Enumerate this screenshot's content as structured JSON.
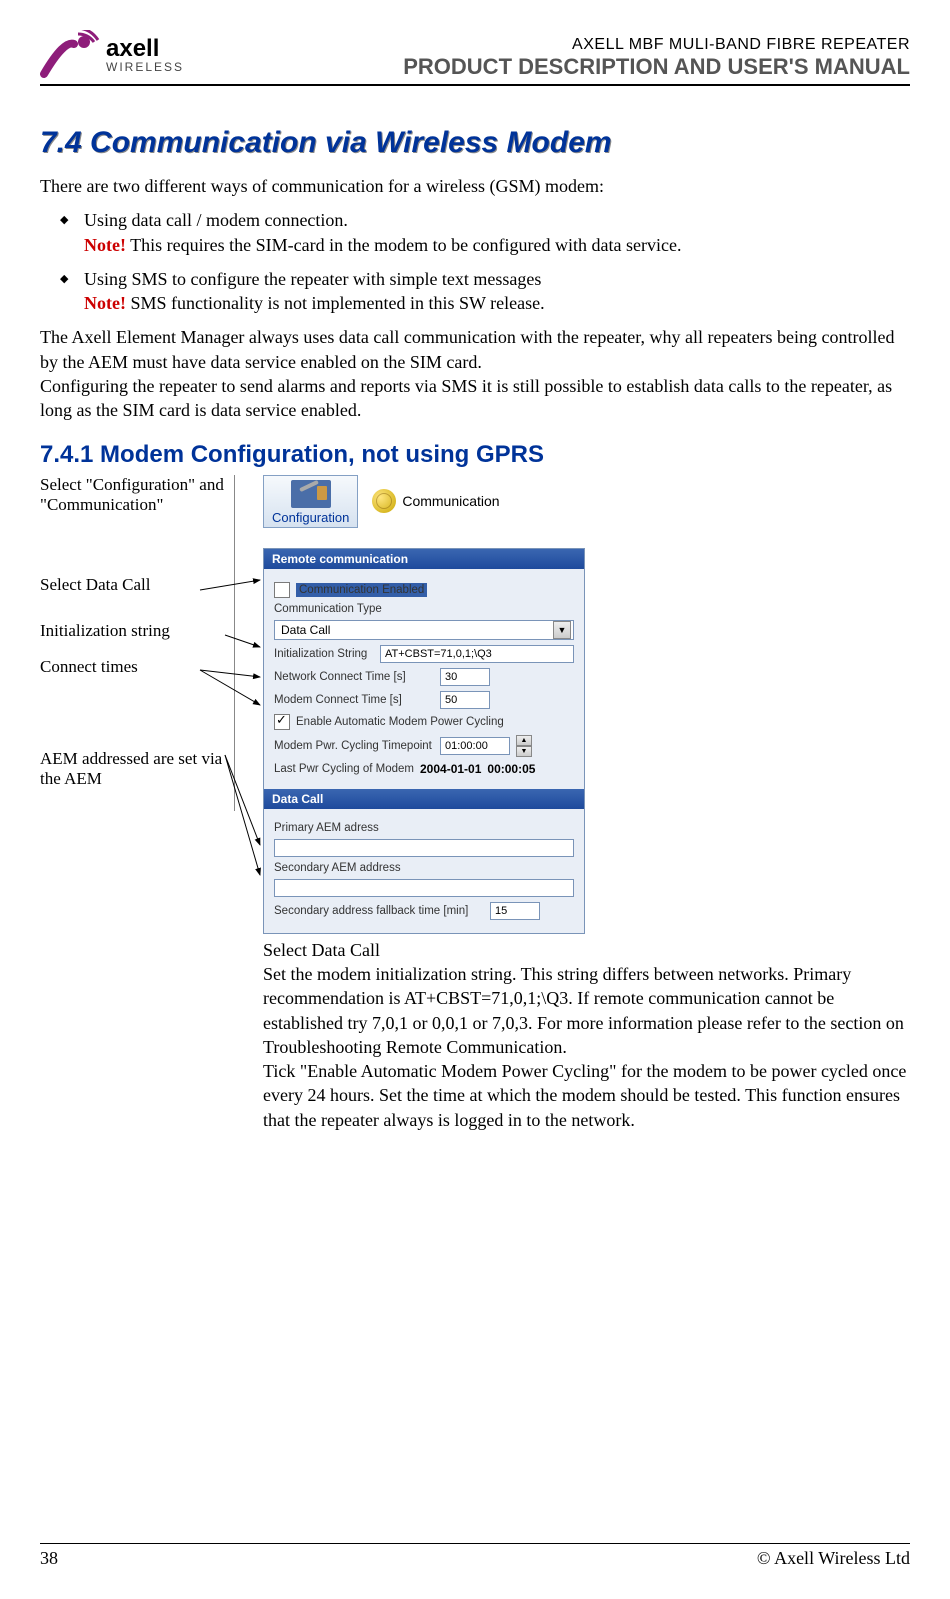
{
  "header": {
    "logo_brand": "axell",
    "logo_subtitle": "WIRELESS",
    "product_line": "AXELL MBF MULI-BAND FIBRE REPEATER",
    "manual_line": "PRODUCT DESCRIPTION AND USER'S MANUAL"
  },
  "section": {
    "number_title": "7.4  Communication via Wireless Modem",
    "intro": "There are two different ways of communication for a wireless (GSM) modem:",
    "bullet1_line1": "Using data call / modem connection.",
    "bullet1_note_label": "Note!",
    "bullet1_note_text": " This requires the SIM-card in the modem to be configured with data service.",
    "bullet2_line1": "Using SMS to configure the repeater with simple text messages",
    "bullet2_note_label": "Note!",
    "bullet2_note_text": " SMS functionality is not implemented in this SW release.",
    "para2": "The Axell Element Manager always uses data call communication with the repeater, why all repeaters being controlled by the AEM must have data service enabled on the SIM card.\nConfiguring the repeater to send alarms and reports via SMS it is still possible to establish data calls to the repeater, as long as the SIM card is data service enabled."
  },
  "subsection": {
    "title": "7.4.1   Modem Configuration, not using GPRS",
    "labels": {
      "l1": "Select \"Configuration\" and \"Communication\"",
      "l2": "Select Data Call",
      "l3": "Initialization string",
      "l4": "Connect times",
      "l5": "AEM addressed are set via the AEM"
    },
    "toolbar": {
      "config": "Configuration",
      "comm": "Communication"
    },
    "panel": {
      "title1": "Remote communication",
      "chk_enabled": "Communication Enabled",
      "lbl_type": "Communication Type",
      "val_type": "Data Call",
      "lbl_init": "Initialization String",
      "val_init": "AT+CBST=71,0,1;\\Q3",
      "lbl_netconn": "Network Connect Time [s]",
      "val_netconn": "30",
      "lbl_modemconn": "Modem Connect Time [s]",
      "val_modemconn": "50",
      "chk_auto": "Enable Automatic Modem Power Cycling",
      "lbl_pwrtime": "Modem Pwr. Cycling Timepoint",
      "val_pwrtime": "01:00:00",
      "lbl_lastpwr": "Last Pwr Cycling of Modem",
      "val_lastpwr_date": "2004-01-01",
      "val_lastpwr_time": "00:00:05",
      "title2": "Data Call",
      "lbl_primary": "Primary AEM adress",
      "lbl_secondary": "Secondary AEM address",
      "lbl_fallback": "Secondary address fallback time [min]",
      "val_fallback": "15"
    },
    "instructions": "Select Data Call\nSet the modem initialization string. This string differs between networks. Primary recommendation is AT+CBST=71,0,1;\\Q3. If remote communication cannot be established try 7,0,1 or 0,0,1 or 7,0,3. For more information please refer to the section on Troubleshooting Remote Communication.\nTick \"Enable Automatic Modem Power Cycling\" for the modem to be power cycled once every 24 hours. Set the time at which the modem should be tested. This function ensures that the repeater always is logged in to the network."
  },
  "footer": {
    "page": "38",
    "copyright": "© Axell Wireless Ltd"
  }
}
